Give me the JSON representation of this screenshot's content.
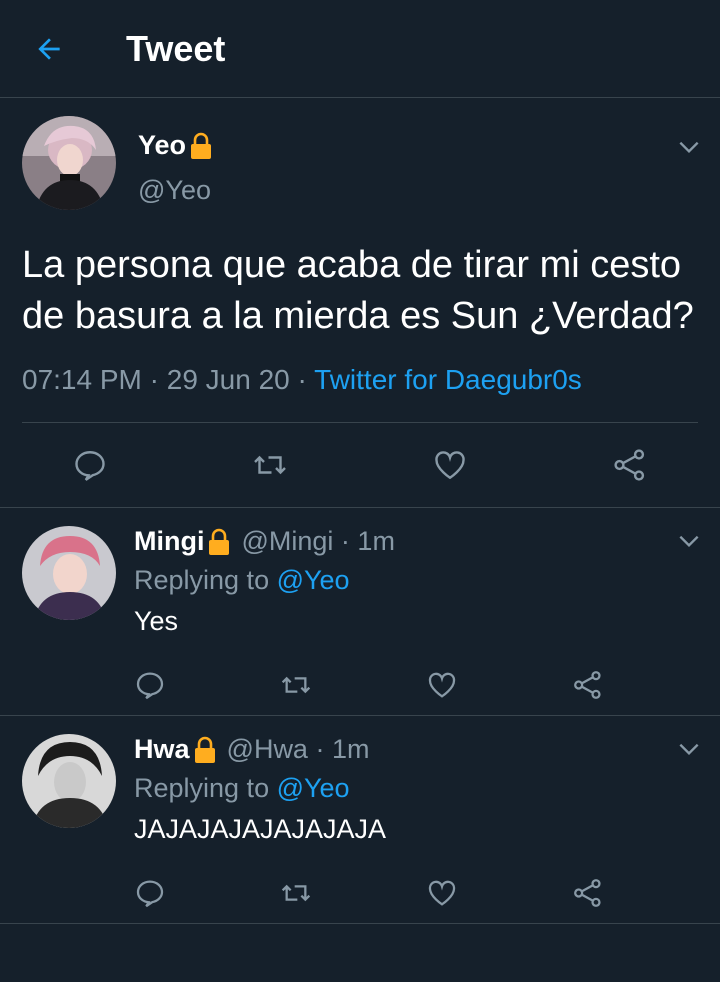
{
  "header": {
    "title": "Tweet"
  },
  "tweet": {
    "name": "Yeo",
    "handle": "@Yeo",
    "text": "La persona que acaba de tirar mi cesto de basura a la mierda es Sun ¿Verdad?",
    "time": "07:14 PM",
    "sep1": " · ",
    "date": "29 Jun 20",
    "sep2": " · ",
    "source": "Twitter for Daegubr0s"
  },
  "replies": [
    {
      "name": "Mingi",
      "handle": "@Mingi",
      "dot": " · ",
      "time": "1m",
      "replying_prefix": "Replying to ",
      "replying_to": "@Yeo",
      "text": "Yes"
    },
    {
      "name": "Hwa",
      "handle": "@Hwa",
      "dot": " · ",
      "time": "1m",
      "replying_prefix": "Replying to ",
      "replying_to": "@Yeo",
      "text": "JAJAJAJAJAJAJAJA"
    }
  ],
  "colors": {
    "background": "#15202b",
    "accent": "#1da1f2",
    "muted": "#8899a6",
    "divider": "#38444d",
    "lock": "#ffad1f"
  },
  "icons": [
    "back-arrow-icon",
    "lock-icon",
    "chevron-down-icon",
    "reply-icon",
    "retweet-icon",
    "like-icon",
    "share-icon"
  ]
}
